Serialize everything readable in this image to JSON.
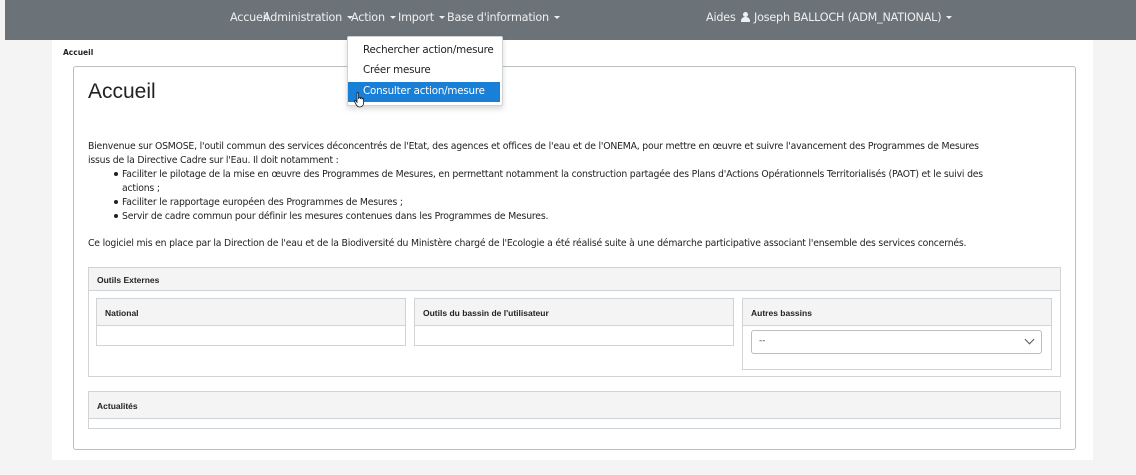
{
  "navbar": {
    "items": [
      {
        "label": "Accueil",
        "caret": false
      },
      {
        "label": "Administration",
        "caret": true
      },
      {
        "label": "Action",
        "caret": true
      },
      {
        "label": "Import",
        "caret": true
      },
      {
        "label": "Base d'information",
        "caret": true
      }
    ],
    "help": "Aides",
    "user": "Joseph BALLOCH (ADM_NATIONAL)"
  },
  "breadcrumb": "Accueil",
  "page_title": "Accueil",
  "intro": {
    "line1": "Bienvenue sur OSMOSE, l'outil commun des services déconcentrés de l'Etat, des agences et offices de l'eau et de l'ONEMA, pour mettre en œuvre et suivre l'avancement des Programmes de Mesures",
    "line2": "issus de la Directive Cadre sur l'Eau. Il doit notamment :",
    "bullets": [
      "Faciliter le pilotage de la mise en œuvre des Programmes de Mesures, en permettant notamment la construction partagée des Plans d'Actions Opérationnels Territorialisés (PAOT) et le suivi des",
      "actions ;",
      "Faciliter le rapportage européen des Programmes de Mesures ;",
      "Servir de cadre commun pour définir les mesures contenues dans les Programmes de Mesures."
    ],
    "outro": "Ce logiciel mis en place par la Direction de l'eau et de la Biodiversité du Ministère chargé de l'Ecologie a été réalisé suite à une démarche participative associant l'ensemble des services concernés."
  },
  "outils_externes": {
    "title": "Outils Externes",
    "national": "National",
    "bassin_utilisateur": "Outils du bassin de l'utilisateur",
    "autres_bassins": "Autres bassins",
    "select_value": "--"
  },
  "actualites": {
    "title": "Actualités"
  },
  "action_menu": {
    "items": [
      "Rechercher action/mesure",
      "Créer mesure",
      "Consulter action/mesure"
    ],
    "active_index": 2
  },
  "colors": {
    "navbar": "#6b7378",
    "accent": "#1a7fd6"
  }
}
